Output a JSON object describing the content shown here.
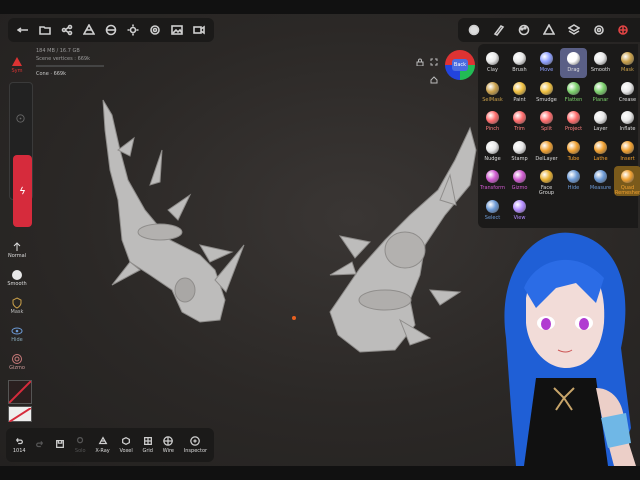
{
  "stats": {
    "memory": "184 MB / 16.7 GB",
    "vertices": "Scene vertices : 669k",
    "object": "Cone · 669k"
  },
  "nav_cube": {
    "label": "Back"
  },
  "left_bar": {
    "symmetry_label": "Sym",
    "stroke_label": "Normal",
    "smooth_label": "Smooth",
    "mask_label": "Mask",
    "hide_label": "Hide",
    "gizmo_label": "Gizmo"
  },
  "bottom_bar": [
    {
      "label": "1014",
      "icon": "undo-icon",
      "dim": false
    },
    {
      "label": "",
      "icon": "redo-icon",
      "dim": true
    },
    {
      "label": "",
      "icon": "save-icon",
      "dim": false
    },
    {
      "label": "Solo",
      "icon": "solo-icon",
      "dim": true
    },
    {
      "label": "X-Ray",
      "icon": "xray-icon",
      "dim": false
    },
    {
      "label": "Voxel",
      "icon": "voxel-icon",
      "dim": false
    },
    {
      "label": "Grid",
      "icon": "grid-icon",
      "dim": false
    },
    {
      "label": "Wire",
      "icon": "wire-icon",
      "dim": false
    },
    {
      "label": "Inspector",
      "icon": "inspector-icon",
      "dim": false
    }
  ],
  "tools": [
    [
      "Clay",
      "Brush",
      "Move",
      "Drag",
      "Smooth",
      "Mask"
    ],
    [
      "SelMask",
      "Paint",
      "Smudge",
      "Flatten",
      "Planar",
      "Crease"
    ],
    [
      "Pinch",
      "Trim",
      "Split",
      "Project",
      "Layer",
      "Inflate"
    ],
    [
      "Nudge",
      "Stamp",
      "DelLayer",
      "Tube",
      "Lathe",
      "Insert"
    ],
    [
      "Transform",
      "Gizmo",
      "Face Group",
      "Hide",
      "Measure",
      "Quad Remesher"
    ],
    [
      "Select",
      "View"
    ]
  ],
  "active_tool": "Drag",
  "colors": {
    "accent_red": "#d62b3c",
    "active_tool": "#5a5f86",
    "panel": "#1b1a19",
    "viewport": "#2b2826"
  }
}
